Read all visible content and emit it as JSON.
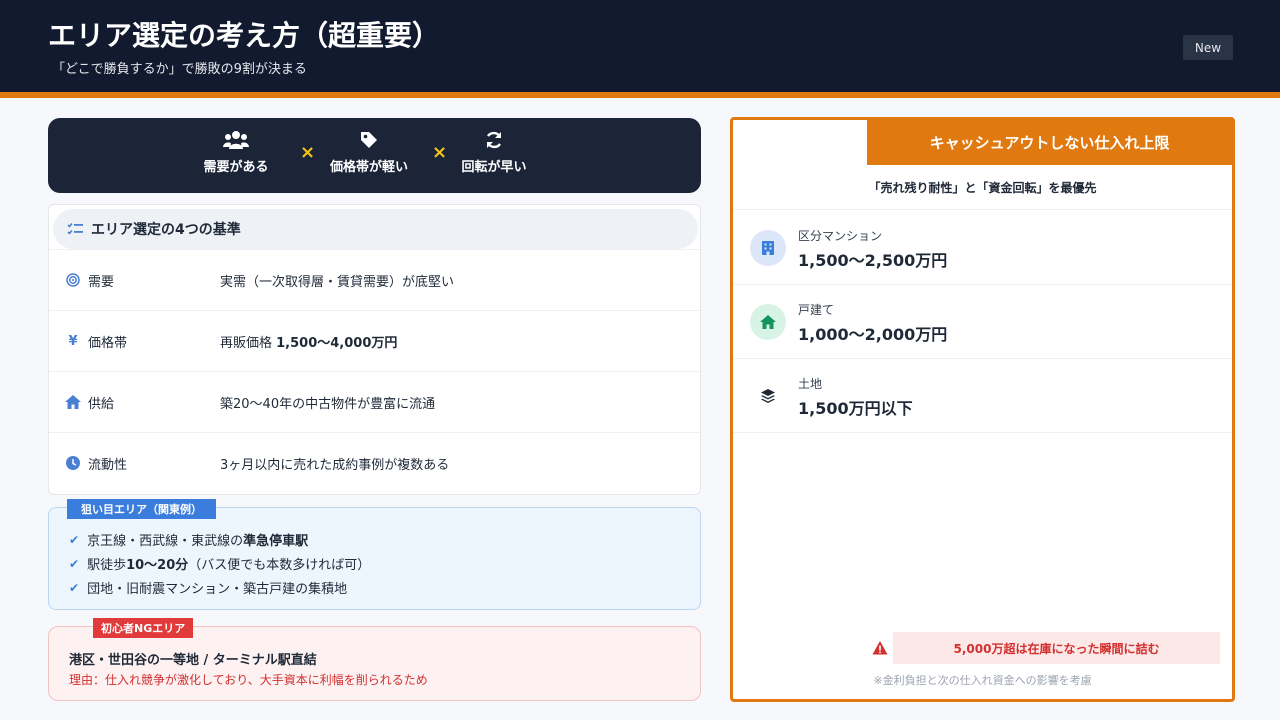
{
  "header": {
    "title": "エリア選定の考え方（超重要）",
    "subtitle": "「どこで勝負するか」で勝敗の9割が決まる",
    "badge": "New"
  },
  "formula": {
    "items": [
      {
        "label": "需要がある",
        "icon": "users-icon"
      },
      {
        "label": "価格帯が軽い",
        "icon": "tag-icon"
      },
      {
        "label": "回転が早い",
        "icon": "refresh-icon"
      }
    ],
    "operator": "×"
  },
  "criteria": {
    "title": "エリア選定の4つの基準",
    "rows": [
      {
        "name": "需要",
        "desc": "実需（一次取得層・賃貸需要）が底堅い",
        "icon": "target-icon"
      },
      {
        "name": "価格帯",
        "desc_prefix": "再販価格 ",
        "desc_bold": "1,500〜4,000万円",
        "icon": "yen-icon",
        "icon_glyph": "¥"
      },
      {
        "name": "供給",
        "desc": "築20〜40年の中古物件が豊富に流通",
        "icon": "home-icon"
      },
      {
        "name": "流動性",
        "desc": "3ヶ月以内に売れた成約事例が複数ある",
        "icon": "clock-icon"
      }
    ]
  },
  "target": {
    "tag": "狙い目エリア（関東例）",
    "items": [
      {
        "prefix": "京王線・西武線・東武線の",
        "bold": "準急停車駅",
        "suffix": ""
      },
      {
        "prefix": "駅徒歩",
        "bold": "10〜20分",
        "suffix": "（バス便でも本数多ければ可）"
      },
      {
        "prefix": "団地・旧耐震マンション・築古戸建の集積地",
        "bold": "",
        "suffix": ""
      }
    ]
  },
  "ng": {
    "tag": "初心者NGエリア",
    "title": "港区・世田谷の一等地 / ターミナル駅直結",
    "reason": "理由：仕入れ競争が激化しており、大手資本に利幅を削られるため"
  },
  "limit": {
    "title": "キャッシュアウトしない仕入れ上限",
    "subtitle": "「売れ残り耐性」と「資金回転」を最優先",
    "items": [
      {
        "name": "区分マンション",
        "value": "1,500〜2,500万円",
        "icon": "building-icon",
        "icon_bg": "#dbe7f8",
        "icon_color": "#3b7ddd"
      },
      {
        "name": "戸建て",
        "value": "1,000〜2,000万円",
        "icon": "house-icon",
        "icon_bg": "#d7f3e6",
        "icon_color": "#15935c"
      },
      {
        "name": "土地",
        "value": "1,500万円以下",
        "icon": "layers-icon",
        "icon_bg": "#ffffff",
        "icon_color": "#1f2937"
      }
    ],
    "warning": "5,000万超は在庫になった瞬間に詰む",
    "footnote": "※金利負担と次の仕入れ資金への影響を考慮"
  },
  "colors": {
    "header_bg": "#111a2e",
    "accent": "#e07a10",
    "blue": "#3b7ddd",
    "red": "#d33030"
  }
}
